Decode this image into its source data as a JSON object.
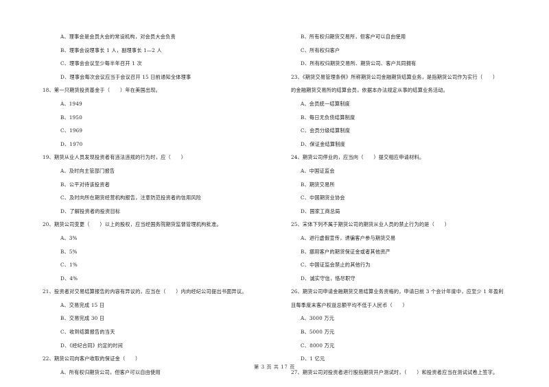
{
  "left_column": [
    {
      "type": "opt",
      "text": "A、理事会是会员大会的常设机构，对会员大会负责"
    },
    {
      "type": "opt",
      "text": "B、理事会设理事长 1 人，副理事长 1—2 人"
    },
    {
      "type": "opt",
      "text": "C、理事会会议至少每半年召开 1 次"
    },
    {
      "type": "opt",
      "text": "D、理事会每次会议应当于会议召开 15 日前通知全体理事"
    },
    {
      "type": "q",
      "text": "18、第一只期货投资基金于（　　）年在美国出现。"
    },
    {
      "type": "opt",
      "text": "A、1949"
    },
    {
      "type": "opt",
      "text": "B、1950"
    },
    {
      "type": "opt",
      "text": "C、1969"
    },
    {
      "type": "opt",
      "text": "D、1970"
    },
    {
      "type": "q",
      "text": "19、期货从业人员发现投资者有违法违规的行为时，应（　　）"
    },
    {
      "type": "opt",
      "text": "A、及时向主管部门报告"
    },
    {
      "type": "opt",
      "text": "B、公平对待该投资者"
    },
    {
      "type": "opt",
      "text": "C、及时向所在期货经营机构报告，注意防范投资者的信用风险"
    },
    {
      "type": "opt",
      "text": "D、了解投资者的投资目标"
    },
    {
      "type": "q",
      "text": "20、期货公司变更（　　）以上的股权，应当经国务院期货监督管理机构批准。"
    },
    {
      "type": "opt",
      "text": "A、3%"
    },
    {
      "type": "opt",
      "text": "B、5%"
    },
    {
      "type": "opt",
      "text": "C、1%"
    },
    {
      "type": "opt",
      "text": "D、4%"
    },
    {
      "type": "q",
      "text": "21、投资者对交易结算报告的内容有异议的，应当在（　　）内向经纪公司提出书面异议。"
    },
    {
      "type": "opt",
      "text": "A、交易完成 15 日"
    },
    {
      "type": "opt",
      "text": "B、交易完成 30 日"
    },
    {
      "type": "opt",
      "text": "C、收到结算报告的当天"
    },
    {
      "type": "opt",
      "text": "D、《经纪合同》约定的时间"
    },
    {
      "type": "q",
      "text": "22、期货公司向客户收取的保证金（　　）"
    },
    {
      "type": "opt",
      "text": "A、所有权归期货公司，但客户可以自由使用"
    }
  ],
  "right_column": [
    {
      "type": "opt",
      "text": "B、所有权归期货交易所，但客户可以自由使用"
    },
    {
      "type": "opt",
      "text": "C、所有权归客户"
    },
    {
      "type": "opt",
      "text": "D、所有权归期货交易所、期货公司、客户共同拥有"
    },
    {
      "type": "q",
      "text": "23、《期货交易管理条例》所称期货公司金融期货结算业务，是指期货公司作为实行（　　）"
    },
    {
      "type": "q",
      "text": "的金融期货交易所的结算会员，依据本办法规定从事的结算业务活动。"
    },
    {
      "type": "opt",
      "text": "A、会员统一结算制度"
    },
    {
      "type": "opt",
      "text": "B、每日无负债结算制度"
    },
    {
      "type": "opt",
      "text": "C、会员分级结算制度"
    },
    {
      "type": "opt",
      "text": "D、保证金结算制度"
    },
    {
      "type": "q",
      "text": "24、期货公司停业的，应当向（　　）提交相应申请材料。"
    },
    {
      "type": "opt",
      "text": "A、中国证监会"
    },
    {
      "type": "opt",
      "text": "B、期货交易所"
    },
    {
      "type": "opt",
      "text": "C、中国期货业协会"
    },
    {
      "type": "opt",
      "text": "D、国家工商总局"
    },
    {
      "type": "q",
      "text": "25、宋体下列不属于期货公司的期货从业人员的禁止行为的是（　　）"
    },
    {
      "type": "opt",
      "text": "A、进行虚假宣传，诱骗客户参与期货交易"
    },
    {
      "type": "opt",
      "text": "B、挪用客户的期货保证金或者其他资产"
    },
    {
      "type": "opt",
      "text": "C、中国证监会禁止的其他行为"
    },
    {
      "type": "opt",
      "text": "D、诚实守信，恪尽职守"
    },
    {
      "type": "q",
      "text": "26、期货公司申请金融期货交易结算业务资格的，申请日前 3 个会计年度中，应至少 1 年盈利"
    },
    {
      "type": "q",
      "text": "且每季度末客户权益总额平均不低于人民币（　　）"
    },
    {
      "type": "opt",
      "text": "A、3000 万元"
    },
    {
      "type": "opt",
      "text": "B、5000 万元"
    },
    {
      "type": "opt",
      "text": "C、8000 万元"
    },
    {
      "type": "opt",
      "text": "D、1 亿元"
    },
    {
      "type": "q",
      "text": "27、期货公司对投资者进行股指期货开户测试时，（　　）和投资者应当在测试试卷上签字。"
    }
  ],
  "footer": {
    "page_label": "第 3 页 共 17 页"
  }
}
